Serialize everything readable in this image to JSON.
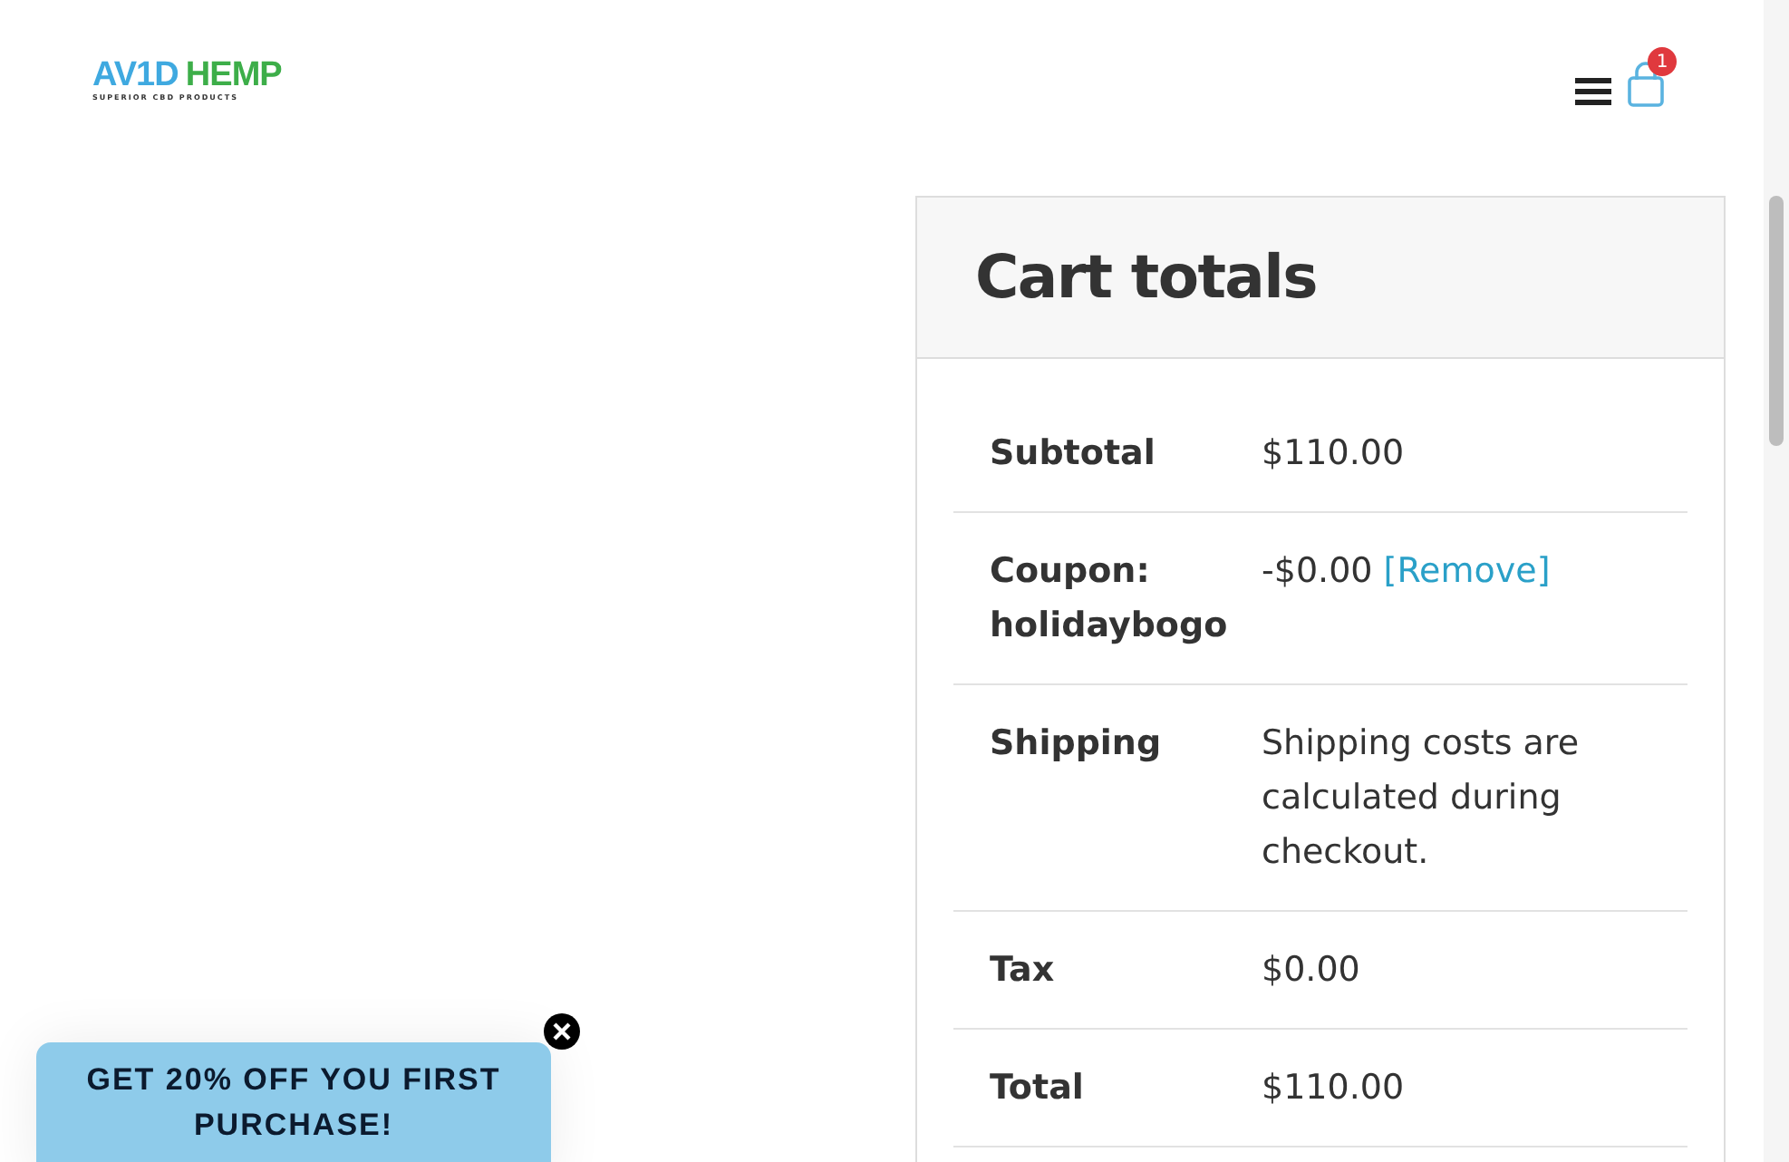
{
  "logo": {
    "name_left": "AV1D",
    "name_right": "HEMP",
    "tagline": "SUPERIOR CBD PRODUCTS"
  },
  "cart": {
    "count": "1"
  },
  "cart_totals": {
    "title": "Cart totals",
    "rows": [
      {
        "label": "Subtotal",
        "value": "$110.00"
      },
      {
        "label": "Coupon: holidaybogo",
        "value": "-$0.00",
        "link": "[Remove]"
      },
      {
        "label": "Shipping",
        "value": "Shipping costs are calculated during checkout."
      },
      {
        "label": "Tax",
        "value": "$0.00"
      },
      {
        "label": "Total",
        "value": "$110.00"
      }
    ]
  },
  "promo": {
    "text": "GET 20% OFF YOU FIRST PURCHASE!"
  }
}
